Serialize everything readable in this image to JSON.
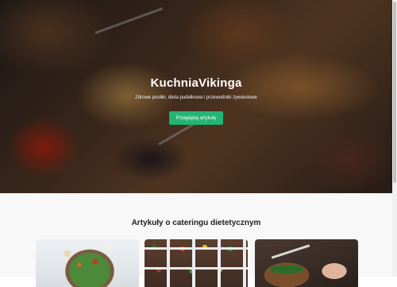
{
  "hero": {
    "title": "KuchniaVikinga",
    "subtitle": "Zdrowe posiłki, dieta pudełkowa i przewodniki żywieniowe",
    "button_label": "Przeglądaj artykuły"
  },
  "articles": {
    "title": "Artykuły o cateringu dietetycznym"
  },
  "colors": {
    "accent": "#22b573",
    "section_background": "#f8f8f8",
    "heading": "#222222"
  }
}
